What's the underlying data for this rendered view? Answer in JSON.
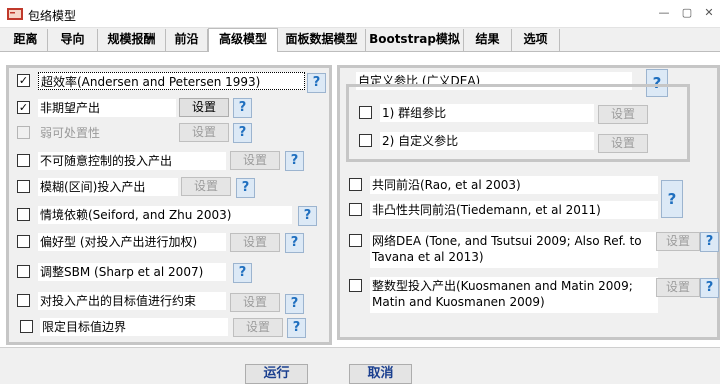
{
  "window": {
    "title": "包络模型",
    "minimize": "—",
    "maximize": "▢",
    "close": "✕"
  },
  "tabs": [
    {
      "label": "距离"
    },
    {
      "label": "导向"
    },
    {
      "label": "规模报酬"
    },
    {
      "label": "前沿"
    },
    {
      "label": "高级模型",
      "active": true
    },
    {
      "label": "面板数据模型"
    },
    {
      "label": "Bootstrap模拟"
    },
    {
      "label": "结果"
    },
    {
      "label": "选项"
    }
  ],
  "left_options": [
    {
      "label": "超效率(Andersen and Petersen 1993)",
      "checked": true
    },
    {
      "label": "非期望产出",
      "checked": true,
      "button": "设置"
    },
    {
      "label": "弱可处置性",
      "disabled": true,
      "button": "设置"
    },
    {
      "label": "不可随意控制的投入产出",
      "button": "设置"
    },
    {
      "label": "模糊(区间)投入产出",
      "button": "设置"
    },
    {
      "label": "情境依赖(Seiford, and Zhu 2003)"
    },
    {
      "label": "偏好型 (对投入产出进行加权)",
      "button": "设置"
    },
    {
      "label": "调整SBM (Sharp et al 2007)"
    },
    {
      "label": "对投入产出的目标值进行约束",
      "button": "设置"
    },
    {
      "label": "限定目标值边界",
      "button": "设置"
    }
  ],
  "custom_ref": {
    "label": "自定义参比 (广义DEA)",
    "group_ref": {
      "label": "1) 群组参比",
      "button": "设置"
    },
    "custom": {
      "label": "2) 自定义参比",
      "button": "设置"
    }
  },
  "right_options": [
    {
      "label": "共同前沿(Rao, et al 2003)"
    },
    {
      "label": "非凸性共同前沿(Tiedemann, et al 2011)"
    },
    {
      "label": "网络DEA (Tone, and Tsutsui 2009; Also Ref. to Tavana et al 2013)",
      "button": "设置"
    },
    {
      "label": "整数型投入产出(Kuosmanen and Matin 2009; Matin and Kuosmanen 2009)",
      "button": "设置"
    }
  ],
  "help": "?",
  "check_mark": "✓",
  "footer": {
    "run": "运行",
    "cancel": "取消"
  }
}
